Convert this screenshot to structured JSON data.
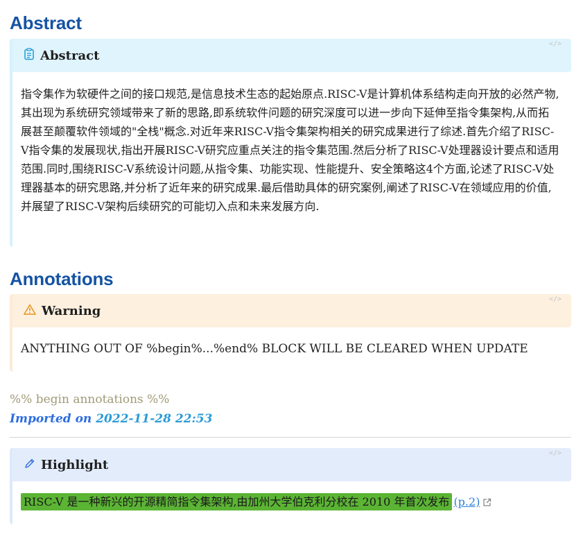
{
  "sections": {
    "abstract_heading": "Abstract",
    "annotations_heading": "Annotations"
  },
  "abstract_callout": {
    "code_tag": "</>",
    "title": "Abstract",
    "icon": "clipboard-icon",
    "text": "指令集作为软硬件之间的接口规范,是信息技术生态的起始原点.RISC-V是计算机体系结构走向开放的必然产物,其出现为系统研究领域带来了新的思路,即系统软件问题的研究深度可以进一步向下延伸至指令集架构,从而拓展甚至颠覆软件领域的\"全栈\"概念.对近年来RISC-V指令集架构相关的研究成果进行了综述.首先介绍了RISC-V指令集的发展现状,指出开展RISC-V研究应重点关注的指令集范围.然后分析了RISC-V处理器设计要点和适用范围.同时,围绕RISC-V系统设计问题,从指令集、功能实现、性能提升、安全策略这4个方面,论述了RISC-V处理器基本的研究思路,并分析了近年来的研究成果.最后借助具体的研究案例,阐述了RISC-V在领域应用的价值,并展望了RISC-V架构后续研究的可能切入点和未来发展方向."
  },
  "warning_callout": {
    "code_tag": "</>",
    "title": "Warning",
    "icon": "warning-icon",
    "text": "ANYTHING OUT OF %begin%...%end% BLOCK WILL BE CLEARED WHEN UPDATE"
  },
  "meta": {
    "begin_marker": "%% begin annotations %%",
    "imported_label": "Imported on",
    "imported_date": "2022-11-28 22:53"
  },
  "highlight_callout": {
    "code_tag": "</>",
    "title": "Highlight",
    "icon": "pencil-icon",
    "text": "RISC-V 是一种新兴的开源精简指令集架构,由加州大学伯克利分校在 2010 年首次发布",
    "page_link": "(p.2)",
    "highlight_color": "#5bb434"
  },
  "colors": {
    "heading": "#1553a3",
    "abstract_bg": "#dff4fd",
    "warning_bg": "#fdf0df",
    "highlight_bg": "#e3ecfb"
  }
}
